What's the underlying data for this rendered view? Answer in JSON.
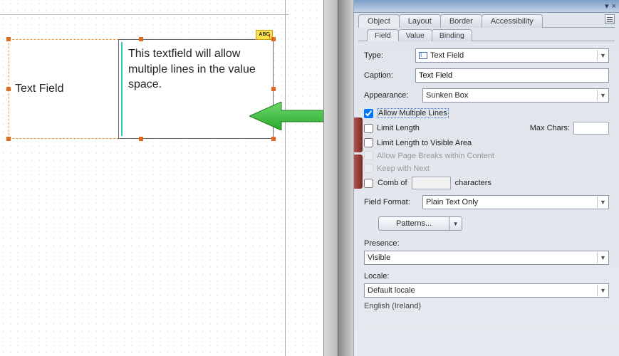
{
  "canvas": {
    "caption_text": "Text Field",
    "value_text": "This textfield will allow multiple lines in the value space.",
    "badge": "ABC"
  },
  "panel": {
    "tabs_top": {
      "object": "Object",
      "layout": "Layout",
      "border": "Border",
      "accessibility": "Accessibility"
    },
    "tabs_sub": {
      "field": "Field",
      "value": "Value",
      "binding": "Binding"
    },
    "type": {
      "label": "Type:",
      "value": "Text Field"
    },
    "caption": {
      "label": "Caption:",
      "value": "Text Field"
    },
    "appearance": {
      "label": "Appearance:",
      "value": "Sunken Box"
    },
    "options": {
      "allow_multiple": "Allow Multiple Lines",
      "limit_length": "Limit Length",
      "max_chars_label": "Max Chars:",
      "limit_visible": "Limit Length to Visible Area",
      "allow_page_breaks": "Allow Page Breaks within Content",
      "keep_with_next": "Keep with Next",
      "comb_of": "Comb of",
      "characters": "characters"
    },
    "field_format": {
      "label": "Field Format:",
      "value": "Plain Text Only"
    },
    "patterns_btn": "Patterns...",
    "presence": {
      "label": "Presence:",
      "value": "Visible"
    },
    "locale": {
      "label": "Locale:",
      "value": "Default locale",
      "resolved": "English (Ireland)"
    }
  }
}
